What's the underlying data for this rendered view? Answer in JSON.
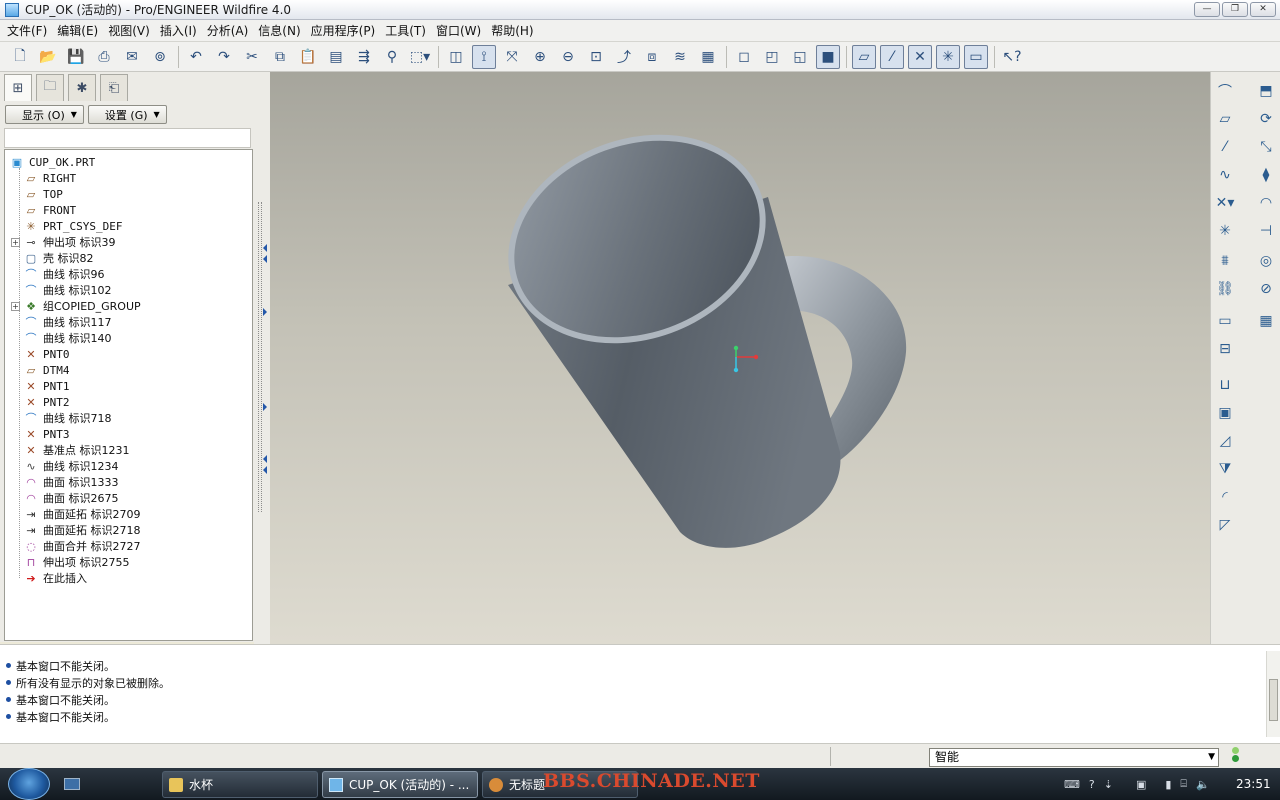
{
  "window": {
    "title": "CUP_OK (活动的) - Pro/ENGINEER Wildfire 4.0",
    "controls": [
      "—",
      "❐",
      "✕"
    ]
  },
  "menu": [
    "文件(F)",
    "编辑(E)",
    "视图(V)",
    "插入(I)",
    "分析(A)",
    "信息(N)",
    "应用程序(P)",
    "工具(T)",
    "窗口(W)",
    "帮助(H)"
  ],
  "toolbar": {
    "icons": [
      "new-icon",
      "open-icon",
      "save-icon",
      "print-icon",
      "email-icon",
      "email-link-icon",
      "undo-icon",
      "redo-icon",
      "cut-icon",
      "copy-icon",
      "paste-icon",
      "paste-special-icon",
      "regenerate-icon",
      "find-icon",
      "select-box-icon",
      "repaint-icon",
      "spin-center-icon",
      "orient-mode-icon",
      "zoom-in-icon",
      "zoom-out-icon",
      "refit-icon",
      "reorient-icon",
      "saved-views-icon",
      "layers-icon",
      "view-manager-icon",
      "wireframe-icon",
      "hidden-line-icon",
      "no-hidden-icon",
      "shading-icon",
      "datum-planes-icon",
      "datum-axes-icon",
      "datum-points-icon",
      "coord-sys-icon",
      "annotations-icon",
      "whats-this-icon"
    ]
  },
  "left_panel": {
    "show_button": "显示 (O)",
    "settings_button": "设置 (G)",
    "tree": [
      {
        "label": "CUP_OK.PRT",
        "icon": "part-icon",
        "level": 0,
        "expand": ""
      },
      {
        "label": "RIGHT",
        "icon": "datum-plane-icon",
        "level": 1,
        "expand": ""
      },
      {
        "label": "TOP",
        "icon": "datum-plane-icon",
        "level": 1,
        "expand": ""
      },
      {
        "label": "FRONT",
        "icon": "datum-plane-icon",
        "level": 1,
        "expand": ""
      },
      {
        "label": "PRT_CSYS_DEF",
        "icon": "csys-icon",
        "level": 1,
        "expand": ""
      },
      {
        "label": "伸出项 标识39",
        "icon": "extrude-icon",
        "level": 1,
        "expand": "+"
      },
      {
        "label": "壳 标识82",
        "icon": "shell-icon",
        "level": 1,
        "expand": ""
      },
      {
        "label": "曲线 标识96",
        "icon": "curve-icon",
        "level": 1,
        "expand": ""
      },
      {
        "label": "曲线 标识102",
        "icon": "curve-icon",
        "level": 1,
        "expand": ""
      },
      {
        "label": "组COPIED_GROUP",
        "icon": "group-icon",
        "level": 1,
        "expand": "+"
      },
      {
        "label": "曲线 标识117",
        "icon": "curve-icon",
        "level": 1,
        "expand": ""
      },
      {
        "label": "曲线 标识140",
        "icon": "curve-icon",
        "level": 1,
        "expand": ""
      },
      {
        "label": "PNT0",
        "icon": "datum-point-icon",
        "level": 1,
        "expand": ""
      },
      {
        "label": "DTM4",
        "icon": "datum-plane-icon",
        "level": 1,
        "expand": ""
      },
      {
        "label": "PNT1",
        "icon": "datum-point-icon",
        "level": 1,
        "expand": ""
      },
      {
        "label": "PNT2",
        "icon": "datum-point-icon",
        "level": 1,
        "expand": ""
      },
      {
        "label": "曲线 标识718",
        "icon": "curve-icon",
        "level": 1,
        "expand": ""
      },
      {
        "label": "PNT3",
        "icon": "datum-point-icon",
        "level": 1,
        "expand": ""
      },
      {
        "label": "基准点 标识1231",
        "icon": "datum-point-icon",
        "level": 1,
        "expand": ""
      },
      {
        "label": "曲线 标识1234",
        "icon": "sketch-curve-icon",
        "level": 1,
        "expand": ""
      },
      {
        "label": "曲面 标识1333",
        "icon": "surface-icon",
        "level": 1,
        "expand": ""
      },
      {
        "label": "曲面 标识2675",
        "icon": "surface-icon",
        "level": 1,
        "expand": ""
      },
      {
        "label": "曲面延拓 标识2709",
        "icon": "extend-icon",
        "level": 1,
        "expand": ""
      },
      {
        "label": "曲面延拓 标识2718",
        "icon": "extend-icon",
        "level": 1,
        "expand": ""
      },
      {
        "label": "曲面合并 标识2727",
        "icon": "merge-icon",
        "level": 1,
        "expand": ""
      },
      {
        "label": "伸出项 标识2755",
        "icon": "protrusion-icon",
        "level": 1,
        "expand": ""
      },
      {
        "label": "在此插入",
        "icon": "insert-here-arrow-icon",
        "level": 1,
        "expand": ""
      }
    ]
  },
  "messages": [
    "基本窗口不能关闭。",
    "所有没有显示的对象已被删除。",
    "基本窗口不能关闭。",
    "基本窗口不能关闭。"
  ],
  "status": {
    "filter_value": "智能"
  },
  "taskbar": {
    "buttons": [
      "水杯",
      "CUP_OK (活动的) - ...",
      "无标题"
    ],
    "watermark": "BBS.CHINADE.NET",
    "clock": "23:51"
  },
  "colors": {
    "viewport_top": "#a6a59c",
    "viewport_bottom": "#dedbd0",
    "cup_body": "#6b737b",
    "selection_blue": "#1e4fa2"
  }
}
